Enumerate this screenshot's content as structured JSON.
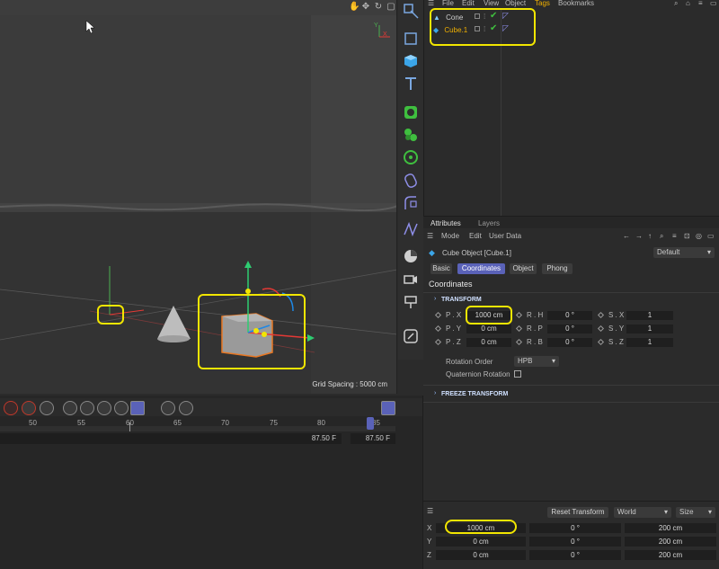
{
  "object_manager": {
    "menu": [
      "File",
      "Edit",
      "View",
      "Object",
      "Tags",
      "Bookmarks"
    ],
    "objects": [
      {
        "name": "Cone",
        "selected": false
      },
      {
        "name": "Cube.1",
        "selected": true
      }
    ]
  },
  "viewport": {
    "grid_spacing": "Grid Spacing : 5000 cm"
  },
  "attributes": {
    "tabs": [
      "Attributes",
      "Layers"
    ],
    "menu": [
      "Mode",
      "Edit",
      "User Data"
    ],
    "object_title": "Cube Object [Cube.1]",
    "preset": "Default",
    "subtabs": [
      "Basic",
      "Coordinates",
      "Object",
      "Phong"
    ],
    "active_subtab": "Coordinates",
    "section_title": "Coordinates",
    "transform_header": "TRANSFORM",
    "pos_labels": [
      "P . X",
      "P . Y",
      "P . Z"
    ],
    "pos_values": [
      "1000 cm",
      "0 cm",
      "0 cm"
    ],
    "rot_labels": [
      "R . H",
      "R . P",
      "R . B"
    ],
    "rot_values": [
      "0 °",
      "0 °",
      "0 °"
    ],
    "scale_labels": [
      "S . X",
      "S . Y",
      "S . Z"
    ],
    "scale_values": [
      "1",
      "1",
      "1"
    ],
    "rotation_order_label": "Rotation Order",
    "rotation_order_value": "HPB",
    "quaternion_label": "Quaternion Rotation",
    "freeze_header": "FREEZE TRANSFORM"
  },
  "timeline": {
    "ticks": [
      "50",
      "55",
      "60",
      "65",
      "70",
      "75",
      "80",
      "85"
    ],
    "current_frame": "87.50 F",
    "end_frame": "87.50 F"
  },
  "coordinates": {
    "reset_button": "Reset Transform",
    "space_value": "World",
    "mode_value": "Size",
    "axis_labels": [
      "X",
      "Y",
      "Z"
    ],
    "position": [
      "1000 cm",
      "0 cm",
      "0 cm"
    ],
    "rotation": [
      "0 °",
      "0 °",
      "0 °"
    ],
    "size": [
      "200 cm",
      "200 cm",
      "200 cm"
    ]
  },
  "colors": {
    "accent": "#5a62b8",
    "highlight": "#f2e600",
    "selected_object": "#f0b000"
  }
}
